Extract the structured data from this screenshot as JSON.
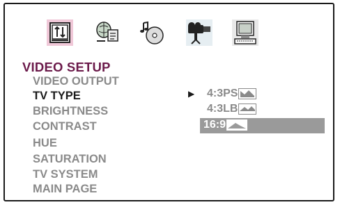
{
  "toolbar": {
    "icons": [
      "system-setup-icon",
      "language-setup-icon",
      "audio-setup-icon",
      "video-setup-icon",
      "preferences-icon"
    ],
    "active_icon": "video-setup-icon"
  },
  "menu": {
    "title": "VIDEO SETUP",
    "items": [
      "VIDEO OUTPUT",
      "TV TYPE",
      "BRIGHTNESS",
      "CONTRAST",
      "HUE",
      "SATURATION",
      "TV SYSTEM",
      "MAIN PAGE"
    ],
    "selected_item": "TV TYPE"
  },
  "submenu": {
    "cursor_glyph": "▶",
    "options": [
      "4:3PS",
      "4:3LB",
      "16:9"
    ],
    "highlighted_option": "16:9"
  },
  "colors": {
    "title": "#6b1a4a",
    "inactive_text": "#8a8a8a",
    "highlight_bar": "#9a9a9a"
  }
}
